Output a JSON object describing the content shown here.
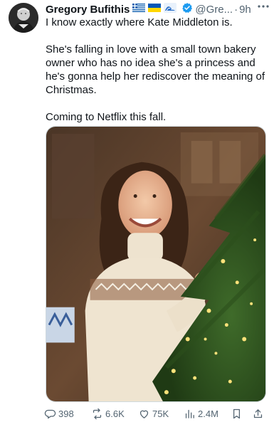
{
  "author": {
    "name": "Gregory Bufithis",
    "handle": "@Gre...",
    "separator": "·",
    "time": "9h"
  },
  "tweet": {
    "line1": "I know exactly where Kate Middleton is.",
    "line2": "She's falling in love with a small town bakery owner who has no idea she's a princess and he's gonna help her rediscover the meaning of Christmas.",
    "line3": "Coming to Netflix this fall."
  },
  "stats": {
    "replies": "398",
    "retweets": "6.6K",
    "likes": "75K",
    "views": "2.4M"
  },
  "icons": {
    "more": "more-icon",
    "reply": "reply-icon",
    "retweet": "retweet-icon",
    "like": "heart-icon",
    "views": "views-icon",
    "bookmark": "bookmark-icon",
    "share": "share-icon"
  },
  "colors": {
    "text": "#0f1419",
    "secondary": "#536471",
    "verified": "#1d9bf0"
  }
}
